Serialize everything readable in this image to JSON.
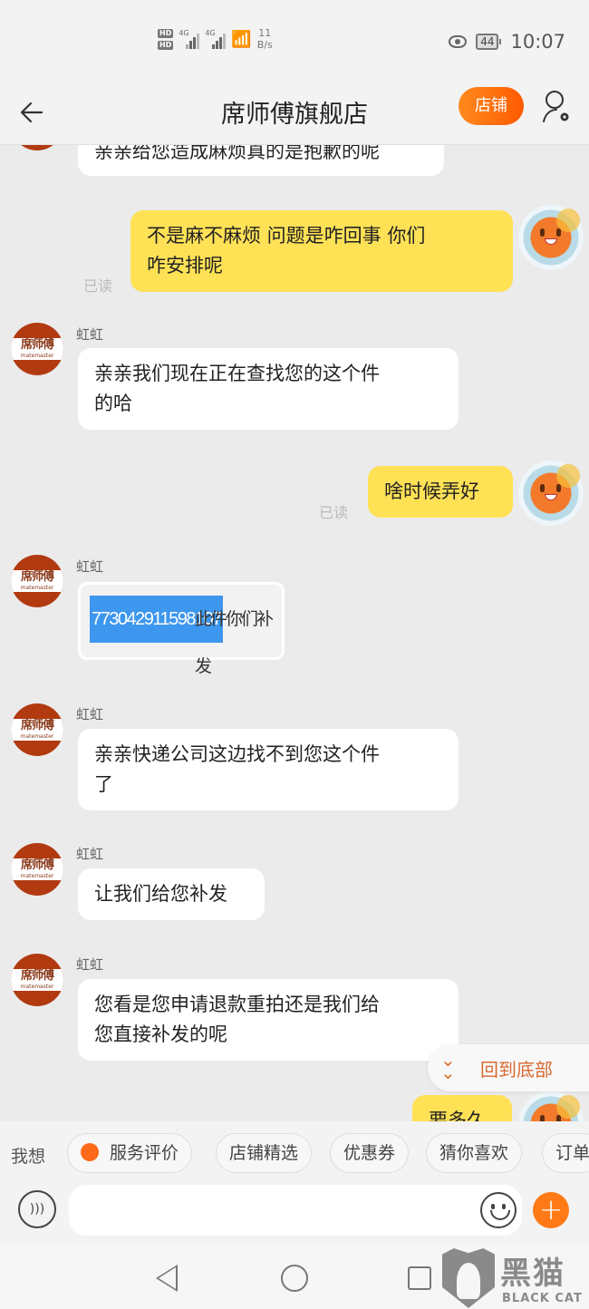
{
  "status_bar": {
    "sim1_label": "HD",
    "sim2_label": "HD",
    "net1": "4G",
    "net2": "4G",
    "speed_value": "11",
    "speed_unit": "B/s",
    "battery": "44",
    "time": "10:07",
    "icons": [
      "hd-icon",
      "signal-icon",
      "wifi-icon",
      "eye-comfort-icon",
      "battery-icon"
    ]
  },
  "header": {
    "back_icon": "arrow-left-icon",
    "title": "席师傅旗舰店",
    "shop_button": "店铺",
    "user_settings_icon": "user-settings-icon"
  },
  "messages": [
    {
      "side": "shop",
      "text": "亲亲给您造成麻烦真的是抱歉的呢",
      "partial": true
    },
    {
      "side": "me",
      "text": "不是麻不麻烦   问题是咋回事 你们\n咋安排呢",
      "read": "已读"
    },
    {
      "side": "shop",
      "nick": "虹虹",
      "text": "亲亲我们现在正在查找您的这个件\n的哈"
    },
    {
      "side": "me",
      "text": "啥时候弄好",
      "read": "已读"
    },
    {
      "side": "shop",
      "nick": "虹虹",
      "type": "image",
      "highlight": "773042911598107",
      "rest": "此件你们补发"
    },
    {
      "side": "shop",
      "nick": "虹虹",
      "text": "亲亲快递公司这边找不到您这个件\n了"
    },
    {
      "side": "shop",
      "nick": "虹虹",
      "text": "让我们给您补发"
    },
    {
      "side": "shop",
      "nick": "虹虹",
      "text": "您看是您申请退款重拍还是我们给\n您直接补发的呢"
    },
    {
      "side": "me",
      "text": "要多久",
      "partial": true
    }
  ],
  "shop_avatar": {
    "logo": "席师傅",
    "sub": "matemaster"
  },
  "scroll_to_bottom": "回到底部",
  "quick_bar": {
    "label": "我想",
    "chips": [
      "服务评价",
      "店铺精选",
      "优惠券",
      "猜你喜欢",
      "订单"
    ]
  },
  "input": {
    "placeholder": "",
    "value": ""
  },
  "nav": {
    "back": "nav-back-icon",
    "home": "nav-home-icon",
    "recent": "nav-recent-icon"
  },
  "watermark": {
    "cn": "黑猫",
    "en": "BLACK CAT"
  },
  "colors": {
    "accent": "#ff6a00",
    "my_bubble": "#ffe156",
    "shop_bubble": "#ffffff",
    "background": "#ebebeb",
    "highlight": "#3e97ee"
  }
}
